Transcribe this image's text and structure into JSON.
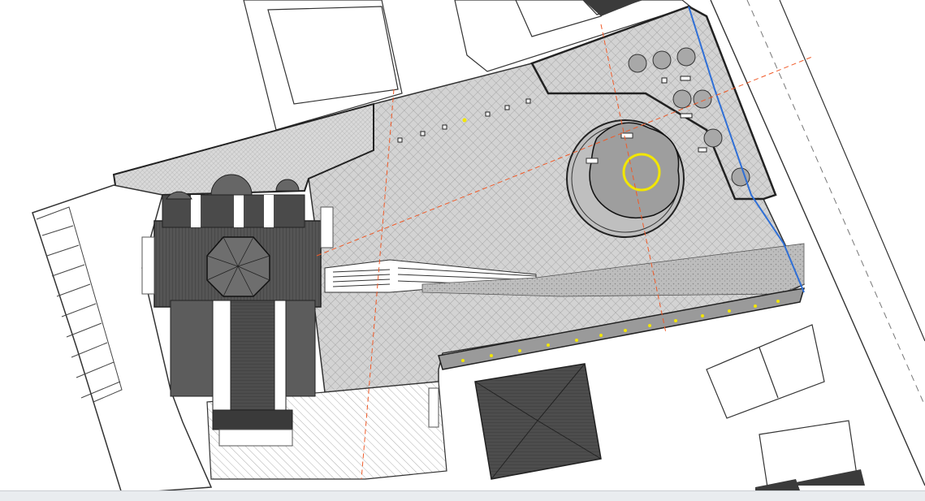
{
  "drawing": {
    "colors": {
      "background": "#ffffff",
      "line": "#2a2a2a",
      "paving": "#cfcfcf",
      "roof_dark": "#4a4a4a",
      "roof_mid": "#6b6b6b",
      "axis_orange": "#f05a28",
      "water_blue": "#2f6fd6",
      "marker_yellow": "#f2e600"
    },
    "icons": [
      "north-arrow-less",
      "tree-symbol",
      "circular-plaza",
      "fountain-ring"
    ]
  }
}
